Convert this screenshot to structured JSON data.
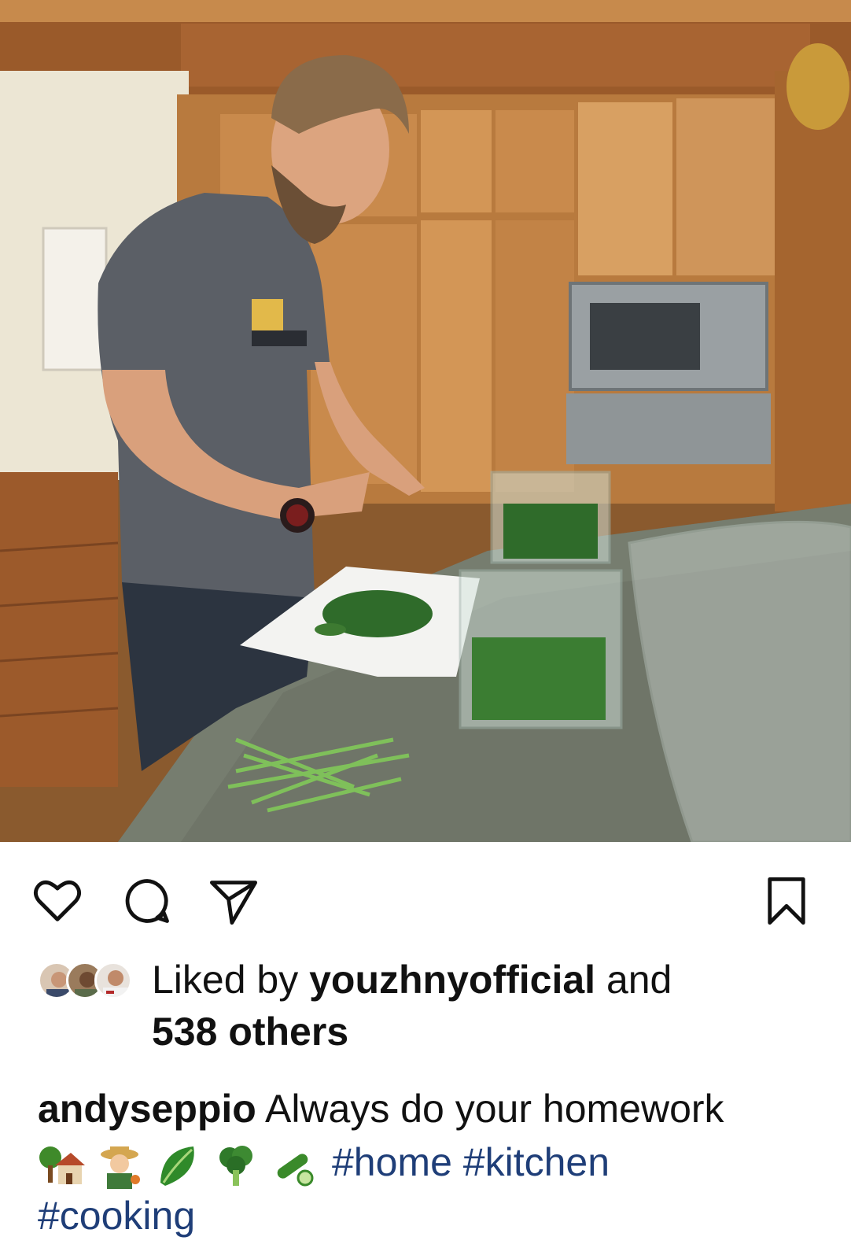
{
  "post": {
    "image_alt": "",
    "actions": {
      "like_icon": "heart-icon",
      "comment_icon": "comment-icon",
      "share_icon": "send-icon",
      "save_icon": "bookmark-icon"
    },
    "likes": {
      "prefix": "Liked by ",
      "user": "youzhnyofficial",
      "connector": " and",
      "others": "538 others"
    },
    "caption": {
      "username": "andyseppio",
      "text": " Always do your homework",
      "emojis": [
        "house-with-garden-emoji",
        "farmer-emoji",
        "leafy-green-emoji",
        "broccoli-emoji",
        "cucumber-emoji"
      ],
      "hashtags": [
        "#home",
        "#kitchen",
        "#cooking"
      ]
    }
  },
  "colors": {
    "hashtag": "#1f3e78",
    "text": "#111111",
    "icon": "#111111"
  }
}
